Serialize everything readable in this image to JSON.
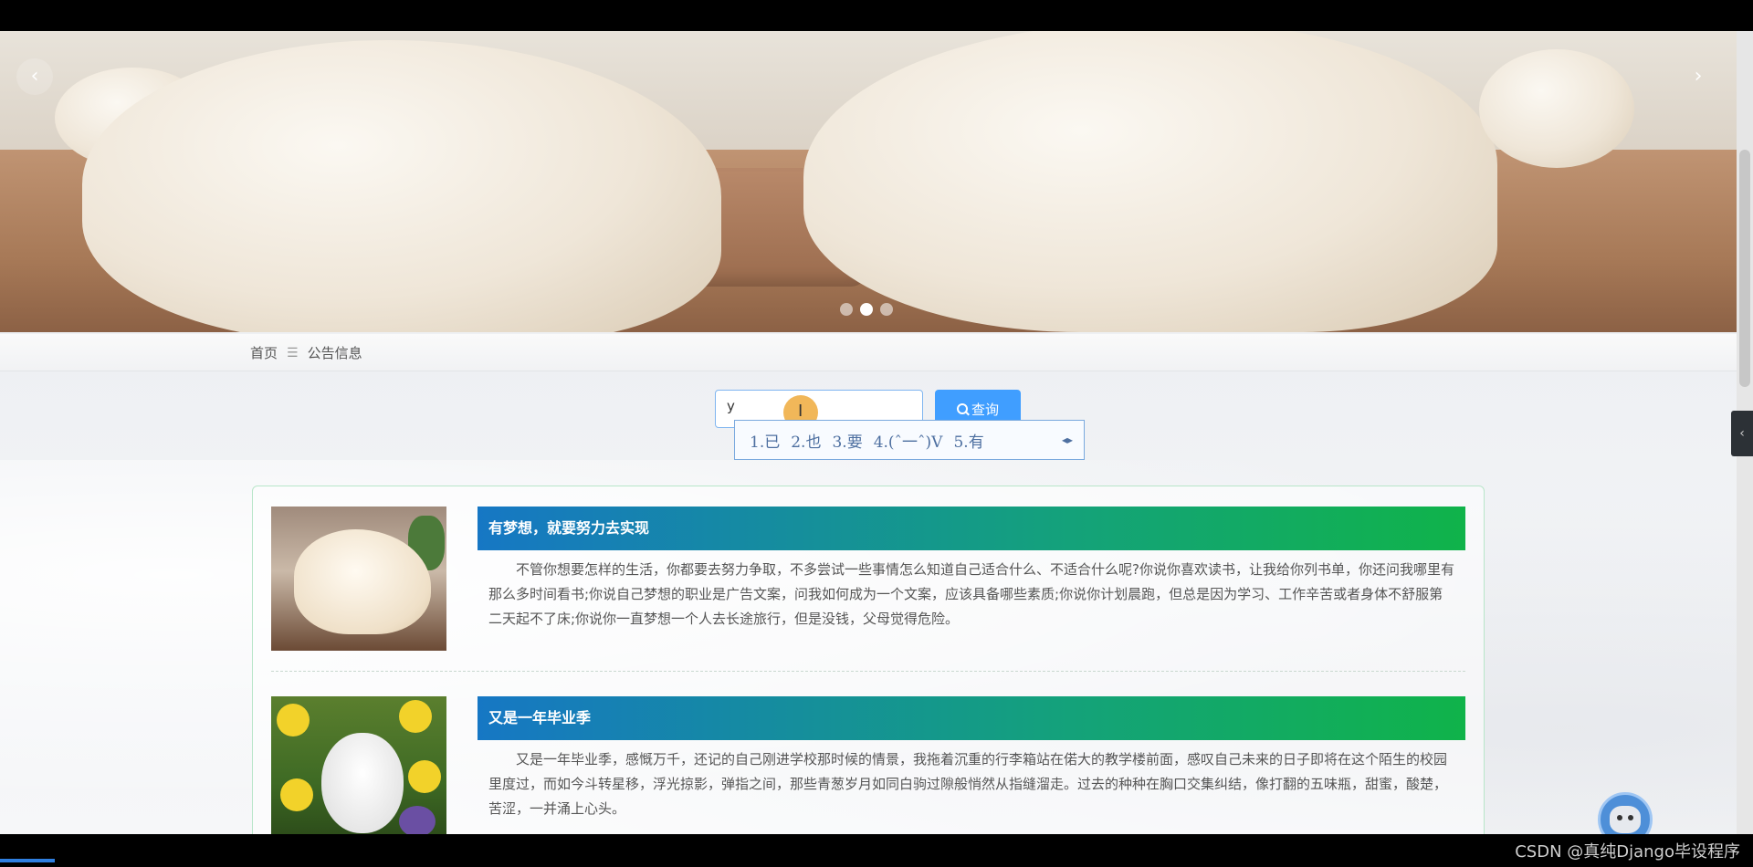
{
  "carousel": {
    "prev_label": "‹",
    "next_label": "›",
    "dots": 3,
    "active_dot": 2
  },
  "breadcrumb": {
    "home": "首页",
    "separator": "☰",
    "current": "公告信息"
  },
  "search": {
    "value": "y",
    "button_label": "查询"
  },
  "ime": {
    "candidates": [
      "1.已",
      "2.也",
      "3.要",
      "4.(ˆ一ˆ)V",
      "5.有"
    ],
    "nav": "◂▸"
  },
  "notices": [
    {
      "title": "有梦想，就要努力去实现",
      "content": "不管你想要怎样的生活，你都要去努力争取，不多尝试一些事情怎么知道自己适合什么、不适合什么呢?你说你喜欢读书，让我给你列书单，你还问我哪里有那么多时间看书;你说自己梦想的职业是广告文案，问我如何成为一个文案，应该具备哪些素质;你说你计划晨跑，但总是因为学习、工作辛苦或者身体不舒服第二天起不了床;你说你一直梦想一个人去长途旅行，但是没钱，父母觉得危险。"
    },
    {
      "title": "又是一年毕业季",
      "content": "又是一年毕业季，感慨万千，还记的自己刚进学校那时候的情景，我拖着沉重的行李箱站在偌大的教学楼前面，感叹自己未来的日子即将在这个陌生的校园里度过，而如今斗转星移，浮光掠影，弹指之间，那些青葱岁月如同白驹过隙般悄然从指缝溜走。过去的种种在胸口交集纠结，像打翻的五味瓶，甜蜜，酸楚，苦涩，一并涌上心头。"
    }
  ],
  "side_tab": "‹",
  "watermark": "CSDN @真纯Django毕设程序",
  "colors": {
    "accent": "#409eff",
    "title_gradient_start": "#1677c4",
    "title_gradient_end": "#10b34a"
  }
}
